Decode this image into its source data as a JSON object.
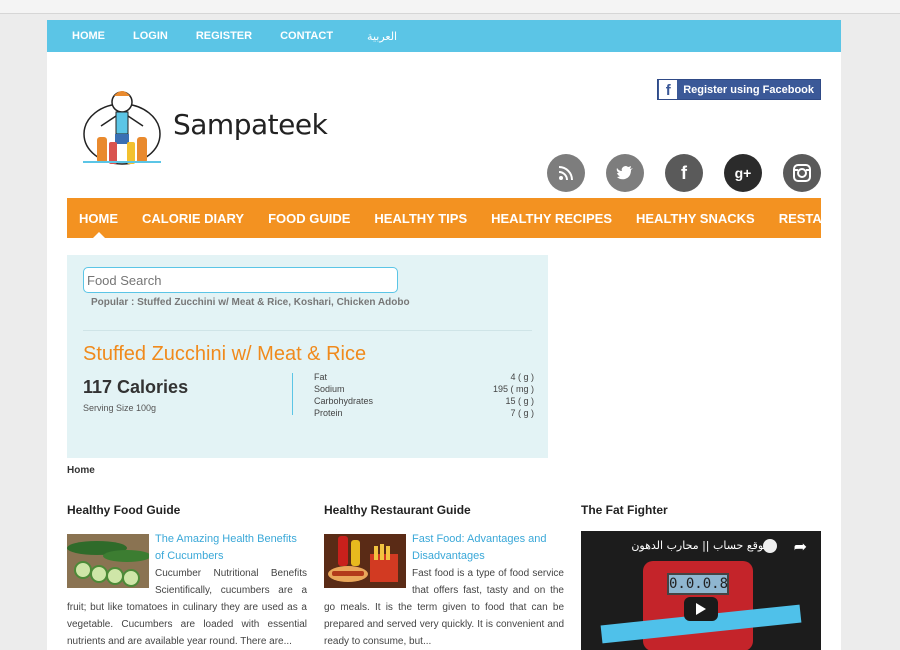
{
  "topnav": [
    "HOME",
    "LOGIN",
    "REGISTER",
    "CONTACT",
    "العربية"
  ],
  "logo": {
    "text": "Sampateek"
  },
  "facebook_button": "Register using Facebook",
  "social_icons": [
    "rss-icon",
    "twitter-icon",
    "facebook-icon",
    "google-plus-icon",
    "instagram-icon"
  ],
  "mainnav": [
    "HOME",
    "CALORIE DIARY",
    "FOOD GUIDE",
    "HEALTHY TIPS",
    "HEALTHY RECIPES",
    "HEALTHY SNACKS",
    "RESTAURANTS"
  ],
  "search": {
    "placeholder": "Food Search"
  },
  "popular": "Popular : Stuffed Zucchini w/ Meat & Rice, Koshari, Chicken Adobo",
  "food": {
    "title": "Stuffed Zucchini w/ Meat & Rice",
    "calories": "117 Calories",
    "serving": "Serving Size 100g",
    "nutrients": [
      {
        "name": "Fat",
        "value": "4 ( g )"
      },
      {
        "name": "Sodium",
        "value": "195 ( mg )"
      },
      {
        "name": "Carbohydrates",
        "value": "15 ( g )"
      },
      {
        "name": "Protein",
        "value": "7 ( g )"
      }
    ]
  },
  "breadcrumb": "Home",
  "columns": {
    "food_guide": {
      "heading": "Healthy Food Guide",
      "title": "The Amazing Health Benefits of Cucumbers",
      "body": "Cucumber Nutritional Benefits Scientifically, cucumbers are a fruit; but like tomatoes in culinary they are used as a vegetable. Cucumbers are loaded with essential nutrients and are available year round. There are..."
    },
    "restaurant_guide": {
      "heading": "Healthy Restaurant Guide",
      "title": "Fast Food: Advantages and Disadvantages",
      "body": "Fast food is a type of food service that offers fast, tasty and on the go meals. It is the term given to food that can be prepared and served very quickly. It is convenient and ready to consume, but..."
    },
    "fat_fighter": {
      "heading": "The Fat Fighter",
      "video_title": "موقع حساب || محارب الدهون.",
      "video_display": "0.0.0.8"
    }
  },
  "colors": {
    "topbar": "#5bc5e6",
    "mainnav": "#f39221",
    "food_box": "#e3f3f5",
    "title_orange": "#f08a1c",
    "link_blue": "#3aa8d8"
  }
}
